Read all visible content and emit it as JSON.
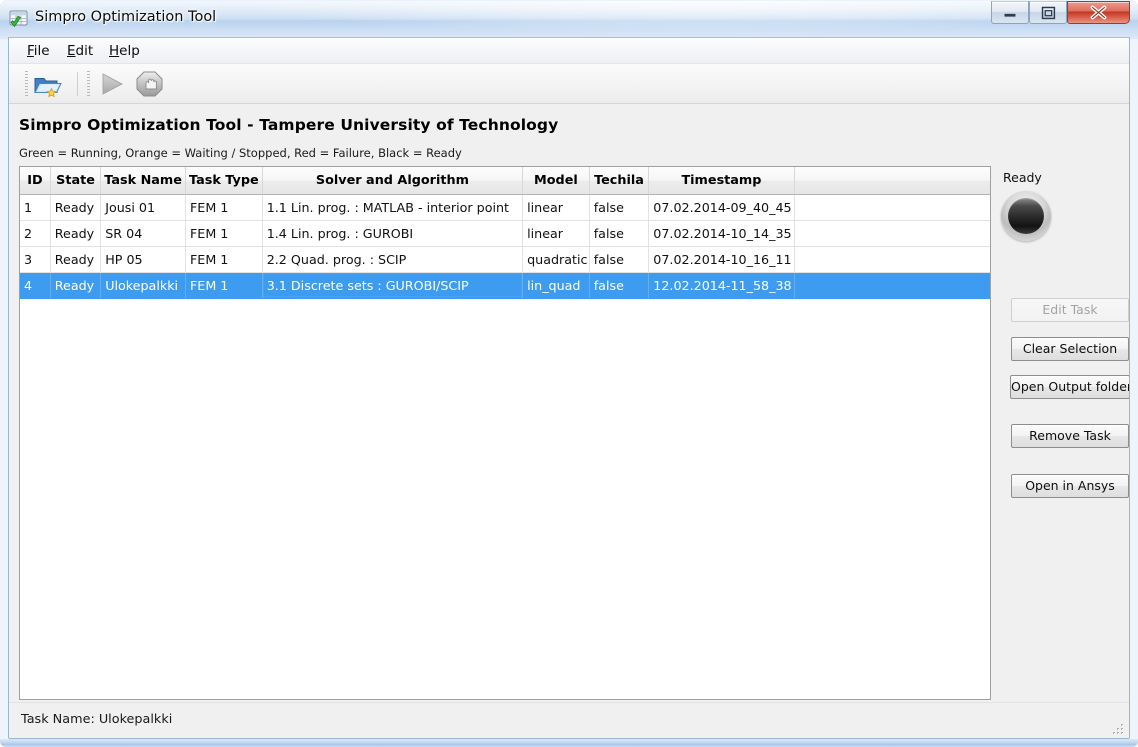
{
  "window": {
    "title": "Simpro Optimization Tool",
    "app_icon": "spreadsheet-check-icon",
    "controls": {
      "minimize": "minimize-icon",
      "maximize": "maximize-icon",
      "close": "close-icon"
    }
  },
  "menubar": {
    "items": [
      {
        "label": "File",
        "mnemonic": "F",
        "rest": "ile"
      },
      {
        "label": "Edit",
        "mnemonic": "E",
        "rest": "dit"
      },
      {
        "label": "Help",
        "mnemonic": "H",
        "rest": "elp"
      }
    ]
  },
  "toolbar": {
    "buttons": [
      {
        "name": "open-project-icon",
        "enabled": true
      },
      {
        "name": "run-icon",
        "enabled": false
      },
      {
        "name": "stop-icon",
        "enabled": false
      }
    ]
  },
  "header": {
    "heading": "Simpro Optimization Tool - Tampere University of Technology",
    "legend": "Green = Running, Orange = Waiting / Stopped, Red = Failure, Black = Ready"
  },
  "table": {
    "columns": [
      "ID",
      "State",
      "Task Name",
      "Task Type",
      "Solver and Algorithm",
      "Model",
      "Techila",
      "Timestamp",
      ""
    ],
    "rows": [
      {
        "id": "1",
        "state": "Ready",
        "task_name": "Jousi 01",
        "task_type": "FEM 1",
        "solver": "1.1 Lin. prog. : MATLAB - interior point",
        "model": "linear",
        "techila": "false",
        "timestamp": "07.02.2014-09_40_45",
        "blank": "",
        "selected": false
      },
      {
        "id": "2",
        "state": "Ready",
        "task_name": "SR 04",
        "task_type": "FEM 1",
        "solver": "1.4 Lin. prog. : GUROBI",
        "model": "linear",
        "techila": "false",
        "timestamp": "07.02.2014-10_14_35",
        "blank": "",
        "selected": false
      },
      {
        "id": "3",
        "state": "Ready",
        "task_name": "HP 05",
        "task_type": "FEM 1",
        "solver": "2.2 Quad. prog. : SCIP",
        "model": "quadratic",
        "techila": "false",
        "timestamp": "07.02.2014-10_16_11",
        "blank": "",
        "selected": false
      },
      {
        "id": "4",
        "state": "Ready",
        "task_name": "Ulokepalkki",
        "task_type": "FEM 1",
        "solver": "3.1 Discrete sets : GUROBI/SCIP",
        "model": "lin_quad",
        "techila": "false",
        "timestamp": "12.02.2014-11_58_38",
        "blank": "",
        "selected": true
      }
    ]
  },
  "sidebar": {
    "status_label": "Ready",
    "led_state": "black",
    "buttons": [
      {
        "label": "Edit Task",
        "enabled": false
      },
      {
        "label": "Clear Selection",
        "enabled": true
      },
      {
        "label": "Open Output folder",
        "enabled": true
      },
      {
        "label": "Remove Task",
        "enabled": true
      },
      {
        "label": "Open in Ansys",
        "enabled": true
      }
    ]
  },
  "statusbar": {
    "text": "Task Name: Ulokepalkki"
  },
  "colors": {
    "selection_blue": "#3d9bf0",
    "title_blue": "#c2d8f0",
    "client_gray": "#f0f0f0",
    "close_red": "#c33a27",
    "focus_outline": "#d98e2b"
  }
}
